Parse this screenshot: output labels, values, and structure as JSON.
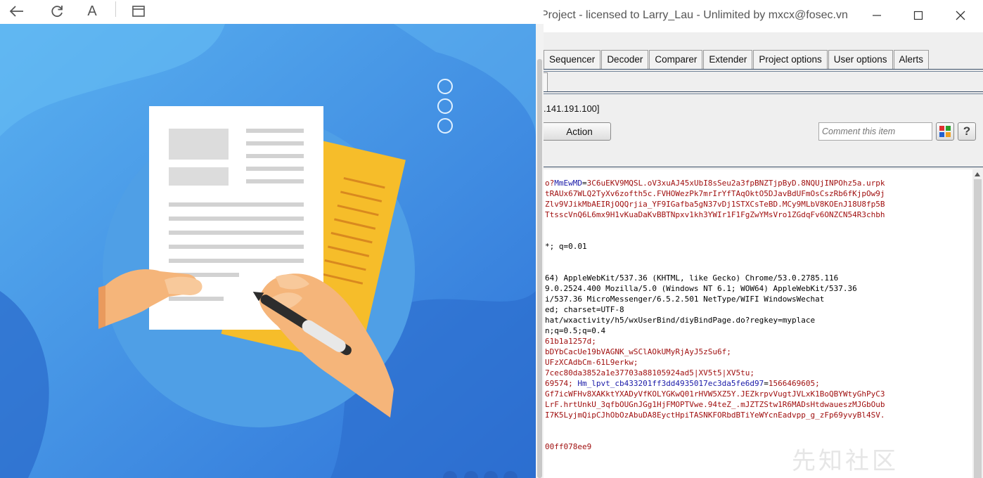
{
  "left_window": {
    "toolbar": {
      "back_icon": "arrow-left-icon",
      "refresh_icon": "refresh-icon",
      "font_label": "A",
      "window_icon": "window-icon"
    }
  },
  "burp": {
    "title": "Project - licensed to Larry_Lau - Unlimited by mxcx@fosec.vn",
    "window_controls": {
      "minimize": "—",
      "maximize": "☐",
      "close": "✕"
    },
    "tabs": [
      "Sequencer",
      "Decoder",
      "Comparer",
      "Extender",
      "Project options",
      "User options",
      "Alerts"
    ],
    "request_label": ".141.191.100]",
    "action_button": "Action",
    "comment_placeholder": "Comment this item",
    "help_button": "?",
    "editor_lines": [
      [
        {
          "t": "o?",
          "c": "red"
        },
        {
          "t": "MmEwMD",
          "c": "blue"
        },
        {
          "t": "=",
          "c": "dark"
        },
        {
          "t": "3C6uEKV9MQSL.oV3xuAJ45xUbI8sSeu2a3fpBNZTjpByD.8NQUjINPOhz5a.urpk",
          "c": "red"
        }
      ],
      [
        {
          "t": "tRAUx67WLQ2TyXv6zofth5c.FVHOWezPk7mrIrYfTAqOktO5DJavBdUFmOsCszRb6fKjpOw9j",
          "c": "red"
        }
      ],
      [
        {
          "t": "Zlv9VJikMbAEIRjOQQrjia_YF9IGafba5gN37vDj1STXCsTeBD.MCy9MLbV8KOEnJ18U8fp5B",
          "c": "red"
        }
      ],
      [
        {
          "t": "TtsscVnQ6L6mx9H1vKuaDaKvBBTNpxv1kh3YWIr1F1FgZwYMsVro1ZGdqFv6ONZCN54R3chbh",
          "c": "red"
        }
      ],
      [],
      [],
      [
        {
          "t": "*; q=0.01",
          "c": "dark"
        }
      ],
      [],
      [],
      [
        {
          "t": "64) AppleWebKit/537.36 (KHTML, like Gecko) Chrome/53.0.2785.116",
          "c": "dark"
        }
      ],
      [
        {
          "t": "9.0.2524.400 Mozilla/5.0 (Windows NT 6.1; WOW64) AppleWebKit/537.36",
          "c": "dark"
        }
      ],
      [
        {
          "t": "i/537.36 MicroMessenger/6.5.2.501 NetType/WIFI WindowsWechat",
          "c": "dark"
        }
      ],
      [
        {
          "t": "ed; charset=UTF-8",
          "c": "dark"
        }
      ],
      [
        {
          "t": "hat/wxactivity/h5/wxUserBind/diyBindPage.do?regkey=myplace",
          "c": "dark"
        }
      ],
      [
        {
          "t": "n;q=0.5;q=0.4",
          "c": "dark"
        }
      ],
      [
        {
          "t": "61b1a1257d;",
          "c": "red"
        }
      ],
      [
        {
          "t": "bDYbCacUe19bVAGNK_wSClAOkUMyRjAyJ5zSu6f;",
          "c": "red"
        }
      ],
      [
        {
          "t": "UFzXCAdbCm-61L9erkw;",
          "c": "red"
        }
      ],
      [
        {
          "t": "7cec80da3852a1e37703a88105924ad5|XV5t5|XV5tu;",
          "c": "red"
        }
      ],
      [
        {
          "t": "69574; ",
          "c": "red"
        },
        {
          "t": "Hm_lpvt_cb433201ff3dd4935017ec3da5fe6d97",
          "c": "blue"
        },
        {
          "t": "=",
          "c": "dark"
        },
        {
          "t": "1566469605;",
          "c": "red"
        }
      ],
      [
        {
          "t": "Gf7icWFHv8XAKktYXADyVfKOLYGKwQ01rHVW5XZ5Y.JEZkrpvVugtJVLxK1BoQBYWtyGhPyC3",
          "c": "red"
        }
      ],
      [
        {
          "t": "LrF.hrtUnkU_3qfbOUGnJGg1HjFMOPTVwe.94teZ_.mJZTZStw1R6MADsHtdwaueszMJGbOub",
          "c": "red"
        }
      ],
      [
        {
          "t": "I7K5LyjmQipCJhObOzAbuDA8EyctHpiTASNKFORbdBTiYeWYcnEadvpp_g_zFp69yvyBl4SV.",
          "c": "red"
        }
      ],
      [],
      [],
      [
        {
          "t": "00ff078ee9",
          "c": "red"
        }
      ]
    ]
  },
  "watermark_text": "先知社区",
  "colors": {
    "page_bg": "#3f8de6",
    "burp_chrome": "#efefef",
    "burp_rule": "#3b4f68",
    "text_red": "#a01010",
    "text_blue": "#1a1aa8",
    "folder_yellow": "#f6bd2a"
  }
}
